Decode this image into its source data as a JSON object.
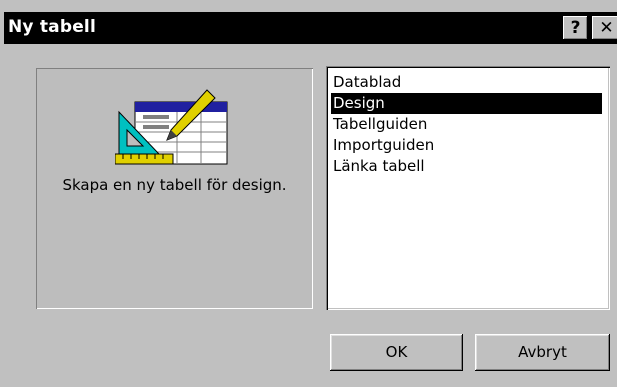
{
  "window": {
    "title": "Ny tabell",
    "help_label": "?",
    "close_label": "✕"
  },
  "preview": {
    "icon": "table-design-icon",
    "caption": "Skapa en ny tabell för design."
  },
  "list": {
    "items": [
      {
        "label": "Datablad",
        "selected": false
      },
      {
        "label": "Design",
        "selected": true
      },
      {
        "label": "Tabellguiden",
        "selected": false
      },
      {
        "label": "Importguiden",
        "selected": false
      },
      {
        "label": "Länka tabell",
        "selected": false
      }
    ]
  },
  "buttons": {
    "ok_label": "OK",
    "cancel_label": "Avbryt"
  },
  "colors": {
    "title_bg": "#000000",
    "dialog_bg": "#c0c0c0",
    "selection_bg": "#000000",
    "icon_blue": "#2020a0",
    "icon_cyan": "#00c0c0",
    "icon_yellow": "#e0d000"
  }
}
